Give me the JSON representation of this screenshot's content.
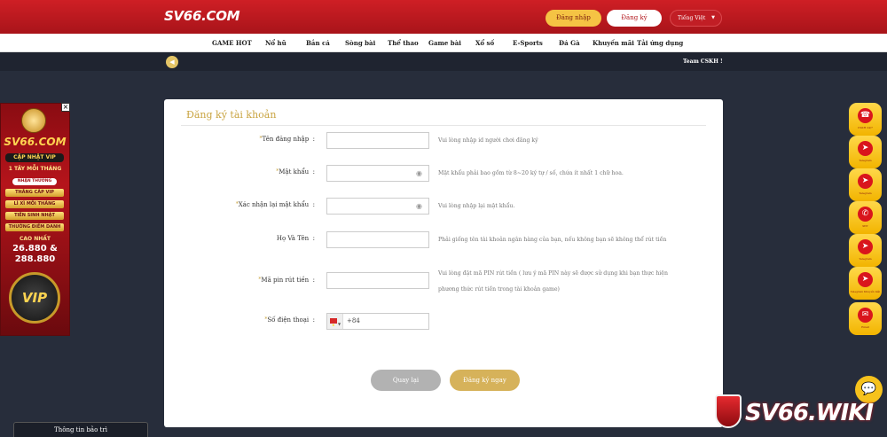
{
  "header": {
    "logo": "SV66.COM",
    "login_label": "Đăng nhập",
    "register_label": "Đăng ký",
    "language": "Tiếng Việt"
  },
  "nav": {
    "items": [
      {
        "label": "GAME HOT"
      },
      {
        "label": "Nổ hũ"
      },
      {
        "label": "Bắn cá"
      },
      {
        "label": "Sòng bài"
      },
      {
        "label": "Thể thao"
      },
      {
        "label": "Game bài"
      },
      {
        "label": "Xổ số"
      },
      {
        "label": "E-Sports"
      },
      {
        "label": "Đá Gà"
      },
      {
        "label": "Khuyến mãi"
      },
      {
        "label": "Tải ứng dụng"
      }
    ]
  },
  "marquee": {
    "text": "Team CSKH !",
    "icon": "speaker-icon"
  },
  "form": {
    "title": "Đăng ký tài khoản",
    "fields": [
      {
        "label": "Tên đăng nhập",
        "value": "",
        "hint": "Vui lòng nhập id người chơi đăng ký"
      },
      {
        "label": "Mật khẩu",
        "value": "",
        "hint": "Mật khẩu phải bao gồm từ 8~20 ký tự / số, chứa ít nhất 1 chữ hoa."
      },
      {
        "label": "Xác nhận lại mật khẩu",
        "value": "",
        "hint": "Vui lòng nhập lại mật khẩu."
      },
      {
        "label": "Họ Và Tên",
        "value": "",
        "hint": "Phải giống tên tài khoản ngân hàng của bạn, nếu không bạn sẽ không thể rút tiền"
      },
      {
        "label": "Mã pin rút tiền",
        "value": "",
        "hint": "Vui lòng đặt mã PIN rút tiền ( lưu ý mã PIN này sẽ được sử dụng khi bạn thực hiện",
        "hint2": "phương thức rút tiền trong tài khoản game)"
      },
      {
        "label": "Số điện thoại",
        "value": "+84",
        "hint": ""
      }
    ],
    "back_label": "Quay lại",
    "submit_label": "Đăng ký ngay"
  },
  "banner": {
    "brand": "SV66.COM",
    "headline": "CẬP NHẬT VIP",
    "line1": "1 TÂY MỖI THÁNG",
    "sub": "NHẬN THƯỞNG",
    "pills": [
      "THĂNG CẤP VIP",
      "LÌ XÌ MỖI THÁNG",
      "TIỀN SINH NHẬT",
      "THƯỞNG ĐIỂM DANH"
    ],
    "max_label": "CAO NHẤT",
    "amount1": "26.880 &",
    "amount2": "288.880",
    "chip": "VIP"
  },
  "maintenance": {
    "label": "Thông tin bảo trì"
  },
  "side_icons": [
    {
      "icon": "headset-icon",
      "label": "CSKH 24/7"
    },
    {
      "icon": "telegram-icon",
      "label": "Telegram"
    },
    {
      "icon": "telegram-icon",
      "label": "Telegram"
    },
    {
      "icon": "phone-icon",
      "label": "SĐT"
    },
    {
      "icon": "telegram-icon",
      "label": "Telegram"
    },
    {
      "icon": "telegram-icon",
      "label": "Telegram Khuyến mãi"
    },
    {
      "icon": "mail-icon",
      "label": "Email"
    }
  ],
  "watermark": {
    "text": "SV66.WIKI"
  },
  "colors": {
    "brand_red": "#c11e25",
    "gold": "#d6b25a",
    "background": "#272d3b"
  }
}
